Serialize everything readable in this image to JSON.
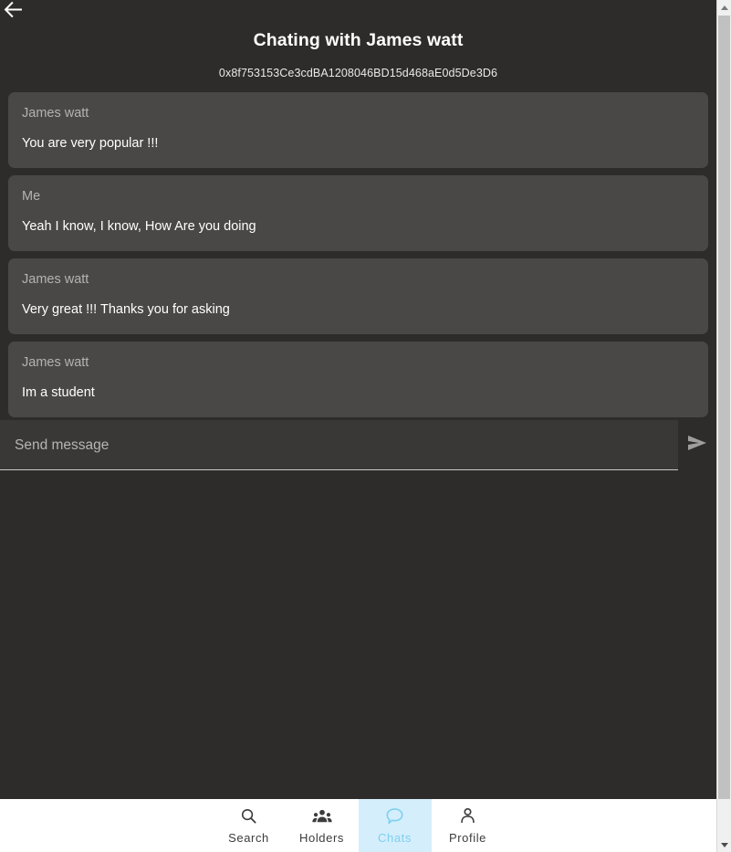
{
  "header": {
    "back_icon": "arrow-left-icon",
    "title": "Chating with James watt",
    "address": "0x8f753153Ce3cdBA1208046BD15d468aE0d5De3D6"
  },
  "messages": [
    {
      "sender": "James watt",
      "text": "You are very popular !!!"
    },
    {
      "sender": "Me",
      "text": "Yeah I know, I know, How Are you doing"
    },
    {
      "sender": "James watt",
      "text": "Very great !!! Thanks you for asking"
    },
    {
      "sender": "James watt",
      "text": "Im a student"
    }
  ],
  "composer": {
    "placeholder": "Send message",
    "value": "",
    "send_icon": "send-paper-plane-icon"
  },
  "bottom_nav": {
    "items": [
      {
        "label": "Search",
        "icon": "search-icon",
        "active": false
      },
      {
        "label": "Holders",
        "icon": "people-group-icon",
        "active": false
      },
      {
        "label": "Chats",
        "icon": "chat-bubble-icon",
        "active": true
      },
      {
        "label": "Profile",
        "icon": "person-icon",
        "active": false
      }
    ],
    "active_bg": "#d4eefb",
    "active_fg": "#7ed0f0",
    "inactive_fg": "#3c3c3c"
  },
  "colors": {
    "page_bg": "#2e2c2b",
    "bubble_bg": "#4a4846",
    "input_bg": "#3a3836",
    "text_primary": "#ffffff",
    "text_muted": "#b3b3b3"
  },
  "scrollbar": {
    "up_icon": "scroll-up-arrow-icon",
    "down_icon": "scroll-down-arrow-icon"
  }
}
